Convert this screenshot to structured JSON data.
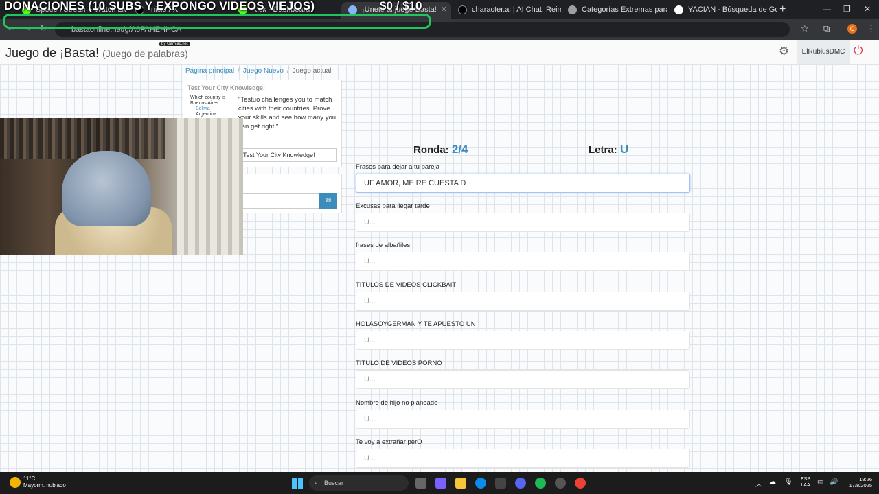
{
  "stream_overlay": {
    "title": "DONACIONES (10 SUBS Y EXPONGO VIDEOS VIEJOS)",
    "money": "$0 / $10"
  },
  "browser": {
    "tabs": [
      {
        "label": "Speech Stream - Watch Live o",
        "active": false
      },
      {
        "label": "Inicio / X",
        "active": false
      },
      {
        "label": "Kick - Dashboard",
        "active": false
      },
      {
        "label": "¡Únete al juego Basta!",
        "active": true
      },
      {
        "label": "character.ai | AI Chat, Reimagin",
        "active": false
      },
      {
        "label": "Categorías Extremas para ju",
        "active": false
      },
      {
        "label": "YACIAN - Búsqueda de Google",
        "active": false
      }
    ],
    "new_tab": "+",
    "url": "bastaonline.net/g/A6FAHEHHCA",
    "profile_initial": "C"
  },
  "site": {
    "title": "Juego de ¡Basta!",
    "subtitle": "(Juego de palabras)",
    "badge": "by Gamiac.net",
    "username": "ElRubiusDMC"
  },
  "breadcrumb": {
    "home": "Página principal",
    "new_game": "Juego Nuevo",
    "current": "Juego actual"
  },
  "ad": {
    "title": "Test Your City Knowledge!",
    "mini_question": "Which country is Buenos Aires",
    "mini_opt1": "Bolivia",
    "mini_opt2": "Argentina",
    "text": "\"Testuo challenges you to match cities with their countries. Prove your skills and see how many you can get right!\"",
    "button": "Test Your City Knowledge!"
  },
  "game": {
    "round_label": "Ronda:",
    "round_value": "2/4",
    "letter_label": "Letra:",
    "letter_value": "U",
    "fields": [
      {
        "label": "Frases para dejar a tu pareja",
        "value": "UF AMOR, ME RE CUESTA D",
        "placeholder": "U..."
      },
      {
        "label": "Excusas para llegar tarde",
        "value": "",
        "placeholder": "U..."
      },
      {
        "label": "frases de albañiles",
        "value": "",
        "placeholder": "U..."
      },
      {
        "label": "TITULOS DE VIDEOS CLICKBAIT",
        "value": "",
        "placeholder": "U..."
      },
      {
        "label": "HOLASOYGERMAN Y TE APUESTO UN",
        "value": "",
        "placeholder": "U..."
      },
      {
        "label": "TITULO DE VIDEOS PORNO",
        "value": "",
        "placeholder": "U..."
      },
      {
        "label": "Nombre de hijo no planeado",
        "value": "",
        "placeholder": "U..."
      },
      {
        "label": "Te voy a extrañar perO",
        "value": "",
        "placeholder": "U..."
      }
    ]
  },
  "taskbar": {
    "temp": "11°C",
    "weather": "Mayorm. nublado",
    "search": "Buscar",
    "lang1": "ESP",
    "lang2": "LAA",
    "time": "19:26",
    "date": "17/8/2025"
  },
  "colors": {
    "accent": "#3c8dbc",
    "power": "#dc3545",
    "frame": "#21c55d"
  }
}
